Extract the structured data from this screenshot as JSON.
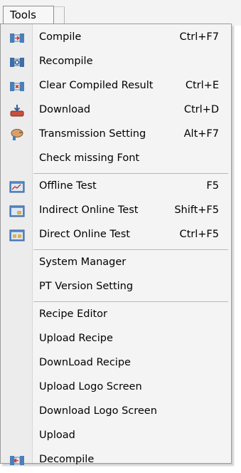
{
  "menu_title": "Tools",
  "groups": [
    [
      {
        "label": "Compile",
        "shortcut": "Ctrl+F7",
        "icon": "compile-icon"
      },
      {
        "label": "Recompile",
        "shortcut": "",
        "icon": "recompile-icon"
      },
      {
        "label": "Clear Compiled Result",
        "shortcut": "Ctrl+E",
        "icon": "clear-compiled-icon"
      },
      {
        "label": "Download",
        "shortcut": "Ctrl+D",
        "icon": "download-icon"
      },
      {
        "label": "Transmission Setting",
        "shortcut": "Alt+F7",
        "icon": "transmission-icon"
      },
      {
        "label": "Check missing Font",
        "shortcut": "",
        "icon": ""
      }
    ],
    [
      {
        "label": "Offline Test",
        "shortcut": "F5",
        "icon": "offline-test-icon"
      },
      {
        "label": "Indirect Online Test",
        "shortcut": "Shift+F5",
        "icon": "indirect-online-test-icon"
      },
      {
        "label": "Direct Online Test",
        "shortcut": "Ctrl+F5",
        "icon": "direct-online-test-icon"
      }
    ],
    [
      {
        "label": "System Manager",
        "shortcut": "",
        "icon": ""
      },
      {
        "label": "PT Version Setting",
        "shortcut": "",
        "icon": ""
      }
    ],
    [
      {
        "label": "Recipe Editor",
        "shortcut": "",
        "icon": ""
      },
      {
        "label": "Upload Recipe",
        "shortcut": "",
        "icon": ""
      },
      {
        "label": "DownLoad Recipe",
        "shortcut": "",
        "icon": ""
      },
      {
        "label": "Upload Logo Screen",
        "shortcut": "",
        "icon": ""
      },
      {
        "label": "Download Logo Screen",
        "shortcut": "",
        "icon": ""
      },
      {
        "label": "Upload",
        "shortcut": "",
        "icon": ""
      },
      {
        "label": "Decompile",
        "shortcut": "",
        "icon": "decompile-icon"
      }
    ]
  ]
}
